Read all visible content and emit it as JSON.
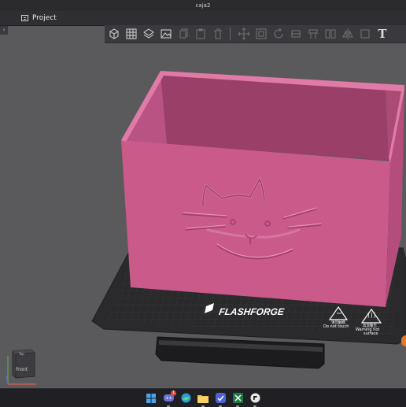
{
  "window": {
    "title": "caja2"
  },
  "menu": {
    "project_label": "Project"
  },
  "toolbar": {
    "tools": [
      "add-object",
      "arrange-grid",
      "layers",
      "image",
      "copy",
      "paste",
      "delete",
      "move",
      "scale",
      "rotate",
      "cut",
      "support",
      "split",
      "mirror",
      "hollow",
      "text"
    ],
    "text_tool_label": "T"
  },
  "build_plate": {
    "brand": "FLASHFORGE",
    "warning_left_cn": "请勿触摸",
    "warning_left": "Do not touch",
    "warning_right_cn": "高温警告",
    "warning_right": "Warning hot surface"
  },
  "model": {
    "color": "#c95a8a"
  },
  "view_cube": {
    "front_label": "Front",
    "top_label": "Top"
  },
  "taskbar": {
    "apps": [
      "windows-start",
      "discord",
      "edge",
      "file-explorer",
      "vpn",
      "excel",
      "flashforge"
    ],
    "discord_badge": "1"
  },
  "colors": {
    "accent": "#e07a2a",
    "viewport_bg": "#5a5a5d",
    "plate": "#2a2a2c"
  }
}
